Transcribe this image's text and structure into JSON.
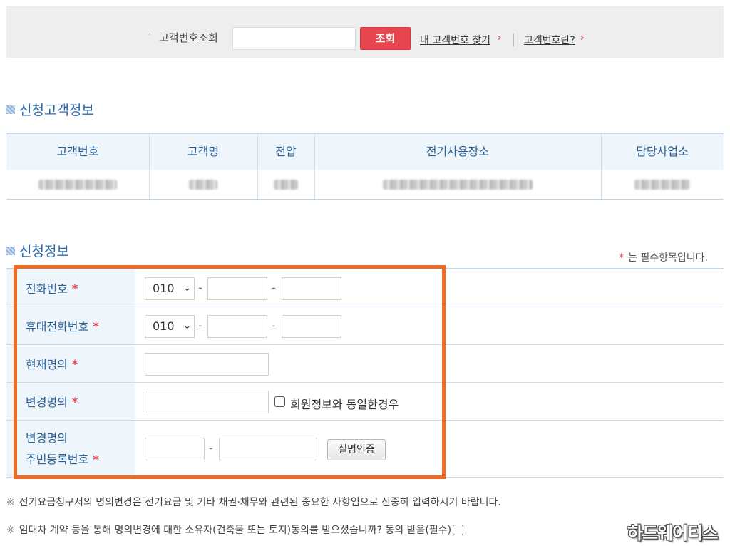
{
  "search": {
    "bullet": "·",
    "label": "고객번호조회",
    "input_value": "",
    "button": "조회",
    "find_link": "내 고객번호 찾기",
    "about_link": "고객번호란?",
    "chevron": "›"
  },
  "customer_section": {
    "title": "신청고객정보",
    "columns": [
      "고객번호",
      "고객명",
      "전압",
      "전기사용장소",
      "담당사업소"
    ]
  },
  "apply_section": {
    "title": "신청정보",
    "required_note": "는 필수항목입니다.",
    "required_star": "*"
  },
  "form": {
    "phone_label": "전화번호",
    "phone_prefix": "010",
    "mobile_label": "휴대전화번호",
    "mobile_prefix": "010",
    "current_name_label": "현재명의",
    "new_name_label": "변경명의",
    "same_as_member": "회원정보와 동일한경우",
    "rrn_label_line1": "변경명의",
    "rrn_label_line2": "주민등록번호",
    "verify_button": "실명인증",
    "dash": "-",
    "star": "*"
  },
  "notes": {
    "mark": "※",
    "note1": "전기요금청구서의 명의변경은 전기요금 및 기타 채권·채무와 관련된 중요한 사항임으로 신중히 입력하시기 바랍니다.",
    "note2": "임대차 계약 등을 통해 명의변경에 대한 소유자(건축물 또는 토지)동의를 받으셨습니까? 동의 받음(필수)"
  },
  "watermark": "하드웨어티스",
  "colors": {
    "accent_blue": "#2a5f94",
    "button_red": "#e8464f",
    "highlight_orange": "#f26a22"
  }
}
